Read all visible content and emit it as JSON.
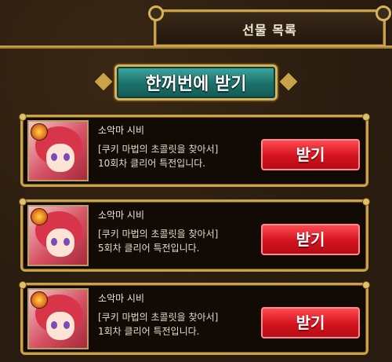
{
  "header": {
    "title": "선물 목록"
  },
  "actions": {
    "claim_all_label": "한꺼번에 받기"
  },
  "gifts": [
    {
      "name": "소악마 시비",
      "desc_line1": "[쿠키 마법의 초콜릿을 찾아서]",
      "desc_line2": "10회차 클리어 특전입니다.",
      "button_label": "받기"
    },
    {
      "name": "소악마 시비",
      "desc_line1": "[쿠키 마법의 초콜릿을 찾아서]",
      "desc_line2": "5회차 클리어 특전입니다.",
      "button_label": "받기"
    },
    {
      "name": "소악마 시비",
      "desc_line1": "[쿠키 마법의 초콜릿을 찾아서]",
      "desc_line2": "1회차 클리어 특전입니다.",
      "button_label": "받기"
    }
  ],
  "icons": {
    "portrait": "character-portrait-icon",
    "badge": "element-badge-icon"
  }
}
